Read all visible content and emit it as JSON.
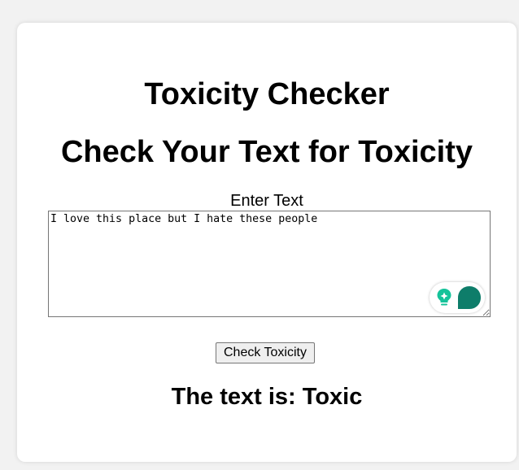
{
  "page": {
    "title": "Toxicity Checker",
    "subtitle": "Check Your Text for Toxicity"
  },
  "form": {
    "label": "Enter Text",
    "text_value": "I love this place but I hate these people",
    "button_label": "Check Toxicity"
  },
  "result": {
    "text": "The text is: Toxic"
  },
  "colors": {
    "page_background": "#f2f2f2",
    "card_background": "#ffffff",
    "grammarly_green": "#15c39a",
    "grammarly_dark_green": "#0e7d6a"
  },
  "icons": {
    "grammarly_suggestion": "lightbulb-icon",
    "grammarly_logo": "grammarly-bubble-icon"
  }
}
